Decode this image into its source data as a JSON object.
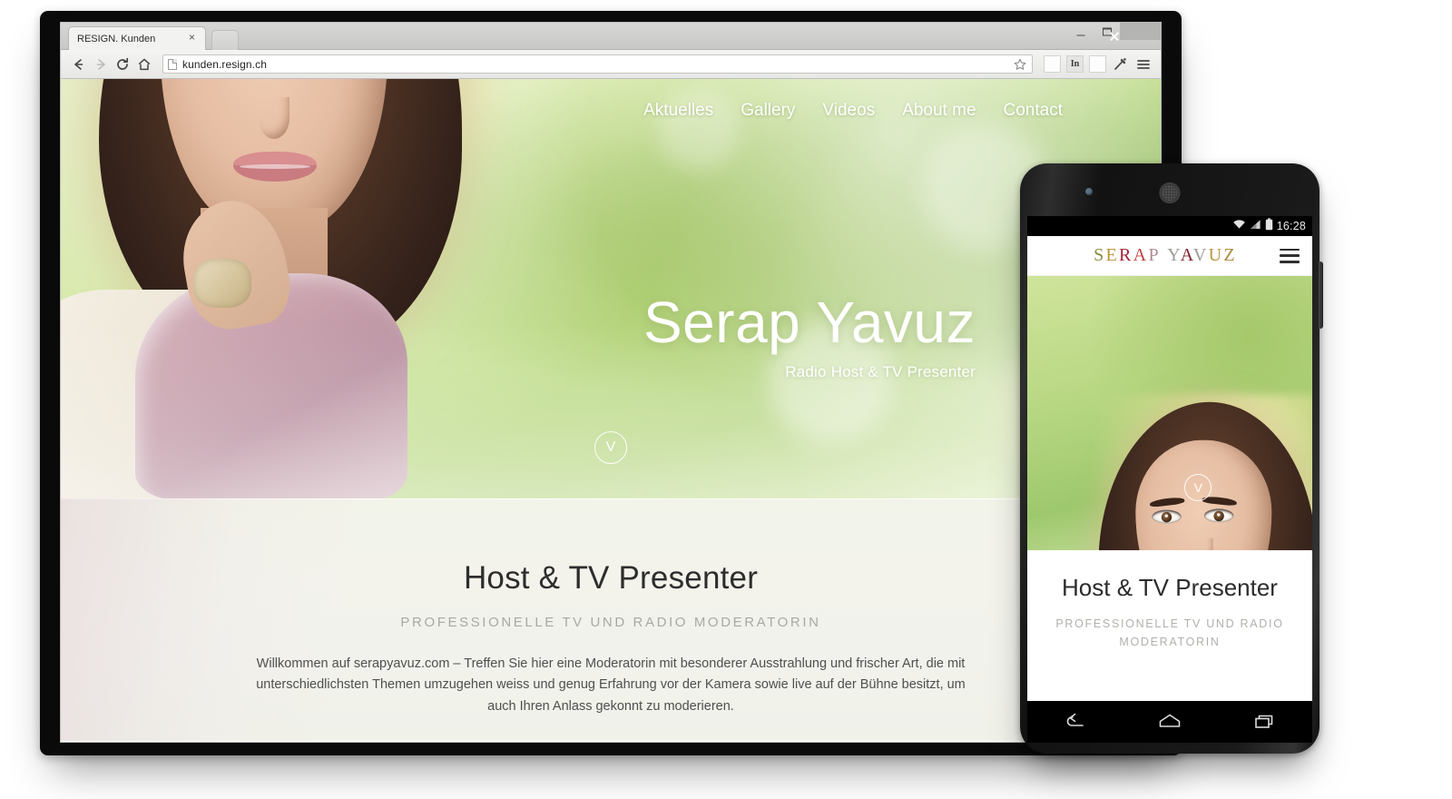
{
  "browser": {
    "tab_title": "RESIGN. Kunden",
    "tab_close_label": "×",
    "url": "kunden.resign.ch",
    "nav_back_icon": "back-arrow-icon",
    "nav_forward_icon": "forward-arrow-icon",
    "nav_reload_icon": "reload-icon",
    "nav_home_icon": "home-icon",
    "bookmark_icon": "star-icon",
    "extension_linkedin_label": "In",
    "extension_blank_label": "",
    "extension_wand_icon": "magic-wand-icon",
    "menu_icon": "hamburger-menu-icon",
    "window_minimize": "minimize-button",
    "window_maximize": "maximize-button",
    "window_close": "close-button"
  },
  "site": {
    "nav": [
      {
        "label": "Aktuelles"
      },
      {
        "label": "Gallery"
      },
      {
        "label": "Videos"
      },
      {
        "label": "About me"
      },
      {
        "label": "Contact"
      }
    ],
    "hero": {
      "title": "Serap Yavuz",
      "subtitle": "Radio Host & TV Presenter",
      "scroll_chevron": "V"
    },
    "intro": {
      "heading": "Host & TV Presenter",
      "subheading": "PROFESSIONELLE TV UND RADIO MODERATORIN",
      "body": "Willkommen auf serapyavuz.com – Treffen Sie hier eine Moderatorin mit besonderer Ausstrahlung und frischer Art, die mit unterschiedlichsten Themen umzugehen weiss und genug Erfahrung vor der Kamera sowie live auf der Bühne besitzt, um auch Ihren Anlass gekonnt zu moderieren."
    }
  },
  "phone": {
    "status": {
      "time": "16:28",
      "wifi_icon": "wifi-icon",
      "signal_icon": "cell-signal-icon",
      "battery_icon": "battery-icon"
    },
    "header": {
      "logo_letters": [
        {
          "char": "S",
          "color": "#8a8c3f"
        },
        {
          "char": "E",
          "color": "#b8953c"
        },
        {
          "char": "R",
          "color": "#a32235"
        },
        {
          "char": "A",
          "color": "#c0433f"
        },
        {
          "char": "P",
          "color": "#b08a8f"
        },
        {
          "char": " ",
          "color": "#ffffff"
        },
        {
          "char": "Y",
          "color": "#9b9b98"
        },
        {
          "char": "A",
          "color": "#7e2230"
        },
        {
          "char": "V",
          "color": "#a09a94"
        },
        {
          "char": "U",
          "color": "#b9963f"
        },
        {
          "char": "Z",
          "color": "#a8893c"
        }
      ],
      "menu_icon": "hamburger-menu-icon"
    },
    "hero": {
      "scroll_chevron": "V"
    },
    "intro": {
      "heading": "Host & TV Presenter",
      "subheading": "PROFESSIONELLE TV UND RADIO MODERATORIN"
    },
    "navbar": {
      "back": "back-nav-icon",
      "home": "home-nav-icon",
      "recents": "recents-nav-icon"
    }
  },
  "colors": {
    "hero_green": "#bcd98c",
    "intro_bg": "#f2f3ec",
    "text_dark": "#2d2d2d",
    "text_muted": "#a9a9a4",
    "chrome_bg": "#d7d7d5"
  }
}
